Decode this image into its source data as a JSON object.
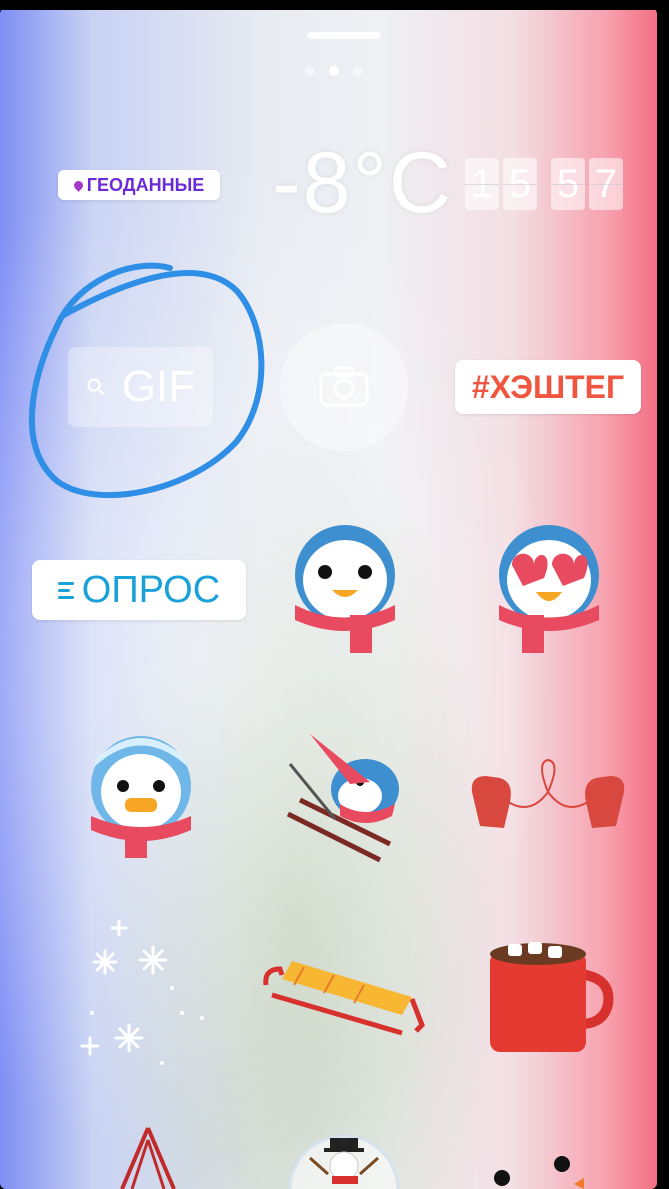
{
  "story_sticker_tray": {
    "page_dots": [
      false,
      true,
      false
    ],
    "stickers": {
      "location_label": "ГЕОДАННЫЕ",
      "temperature": "-8°C",
      "clock_digits": [
        "1",
        "5",
        "5",
        "7"
      ],
      "gif_search_label": "GIF",
      "camera_icon": "camera-icon",
      "hashtag_label": "#ХЭШТЕГ",
      "poll_label": "ОПРОС"
    },
    "emoji_stickers": [
      "penguin-scarf-smile",
      "penguin-heart-eyes",
      "penguin-frozen",
      "penguin-skiing",
      "mittens-heart",
      "snowflakes-sparkles",
      "sled",
      "hot-cocoa-mug",
      "ski-cabin",
      "snowman-snowglobe",
      "snowman-face"
    ],
    "colors": {
      "location_text": "#6b2bd8",
      "hashtag_text": "#f0553f",
      "poll_text": "#1aa1d8",
      "annotation_circle": "#2f8ee6"
    }
  }
}
